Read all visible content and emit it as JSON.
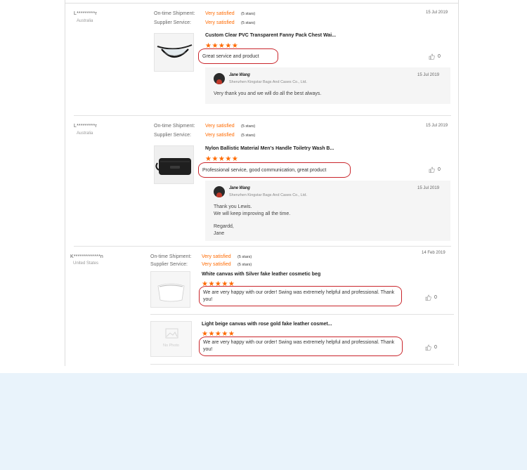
{
  "labels": {
    "shipment": "On-time Shipment:",
    "service": "Supplier Service:"
  },
  "reviews": [
    {
      "buyer": "L*********r",
      "country": "Australia",
      "shipment_rating": "Very satisfied",
      "shipment_stars": "(5 stars)",
      "service_rating": "Very satisfied",
      "service_stars": "(5 stars)",
      "date": "15 Jul 2019",
      "product": "Custom Clear PVC Transparent Fanny Pack Chest Wai...",
      "stars": "★★★★★",
      "feedback": "Great service and product",
      "likes": "0",
      "reply": {
        "name": "Jane Wang",
        "company": "Shenzhen Kingstar Bags And Cases Co., Ltd.",
        "date": "15 Jul 2019",
        "lines": [
          "Very thank you and we will do all the best always."
        ]
      }
    },
    {
      "buyer": "L*********r",
      "country": "Australia",
      "shipment_rating": "Very satisfied",
      "shipment_stars": "(5 stars)",
      "service_rating": "Very satisfied",
      "service_stars": "(5 stars)",
      "date": "15 Jul 2019",
      "product": "Nylon Ballistic Material Men's Handle Toiletry Wash B...",
      "stars": "★★★★★",
      "feedback": "Professional service, good communication, great product",
      "likes": "0",
      "reply": {
        "name": "Jane Wang",
        "company": "Shenzhen Kingstar Bags And Cases Co., Ltd.",
        "date": "15 Jul 2019",
        "lines": [
          "Thank you Lewis.",
          "We will keep improving all the time.",
          "",
          "Regardd,",
          "Jane"
        ]
      }
    },
    {
      "buyer": "K*************n",
      "country": "United States",
      "shipment_rating": "Very satisfied",
      "shipment_stars": "(5 stars)",
      "service_rating": "Very satisfied",
      "service_stars": "(5 stars)",
      "date": "14 Feb 2019",
      "items": [
        {
          "product": "White canvas with Silver fake leather cosmetic beg",
          "stars": "★★★★★",
          "feedback": "We are very happy with our order! Swing was extremely helpful and professional. Thank you!",
          "likes": "0"
        },
        {
          "product": "Light beige canvas with rose gold fake leather cosmet...",
          "stars": "★★★★★",
          "feedback": "We are very happy with our order! Swing was extremely helpful and professional. Thank you!",
          "likes": "0",
          "placeholder": "No Photo"
        }
      ]
    }
  ]
}
